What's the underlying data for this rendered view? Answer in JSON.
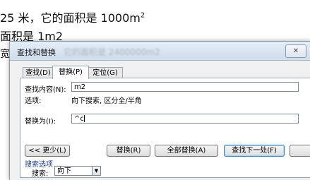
{
  "document": {
    "line1_prefix": "25 米，它的面积是 1000m",
    "line1_sup": "2",
    "line2": "面积是 1m2",
    "line3": "宽"
  },
  "dialog": {
    "title": "查找和替换",
    "title_blurred_text": "它的面积是 2400000m2",
    "close_glyph": "✕",
    "tabs": [
      {
        "label": "查找(D)",
        "active": false
      },
      {
        "label": "替换(P)",
        "active": true
      },
      {
        "label": "定位(G)",
        "active": false
      }
    ],
    "find": {
      "label": "查找内容(N):",
      "value": "m2",
      "options_label": "选项:",
      "options_value": "向下搜索, 区分全/半角"
    },
    "replace": {
      "label": "替换为(I):",
      "value": "^c"
    },
    "buttons": {
      "less": "<< 更少(L)",
      "replace": "替换(R)",
      "replace_all": "全部替换(A)",
      "find_next": "查找下一处(F)"
    },
    "search_options": {
      "heading": "搜索选项",
      "search_label": "搜索:",
      "search_value": "向下"
    }
  },
  "colors": {
    "accent_button_border": "#3c7fb1",
    "titlebar_top": "#e4eef9",
    "titlebar_bottom": "#cfdcea"
  }
}
